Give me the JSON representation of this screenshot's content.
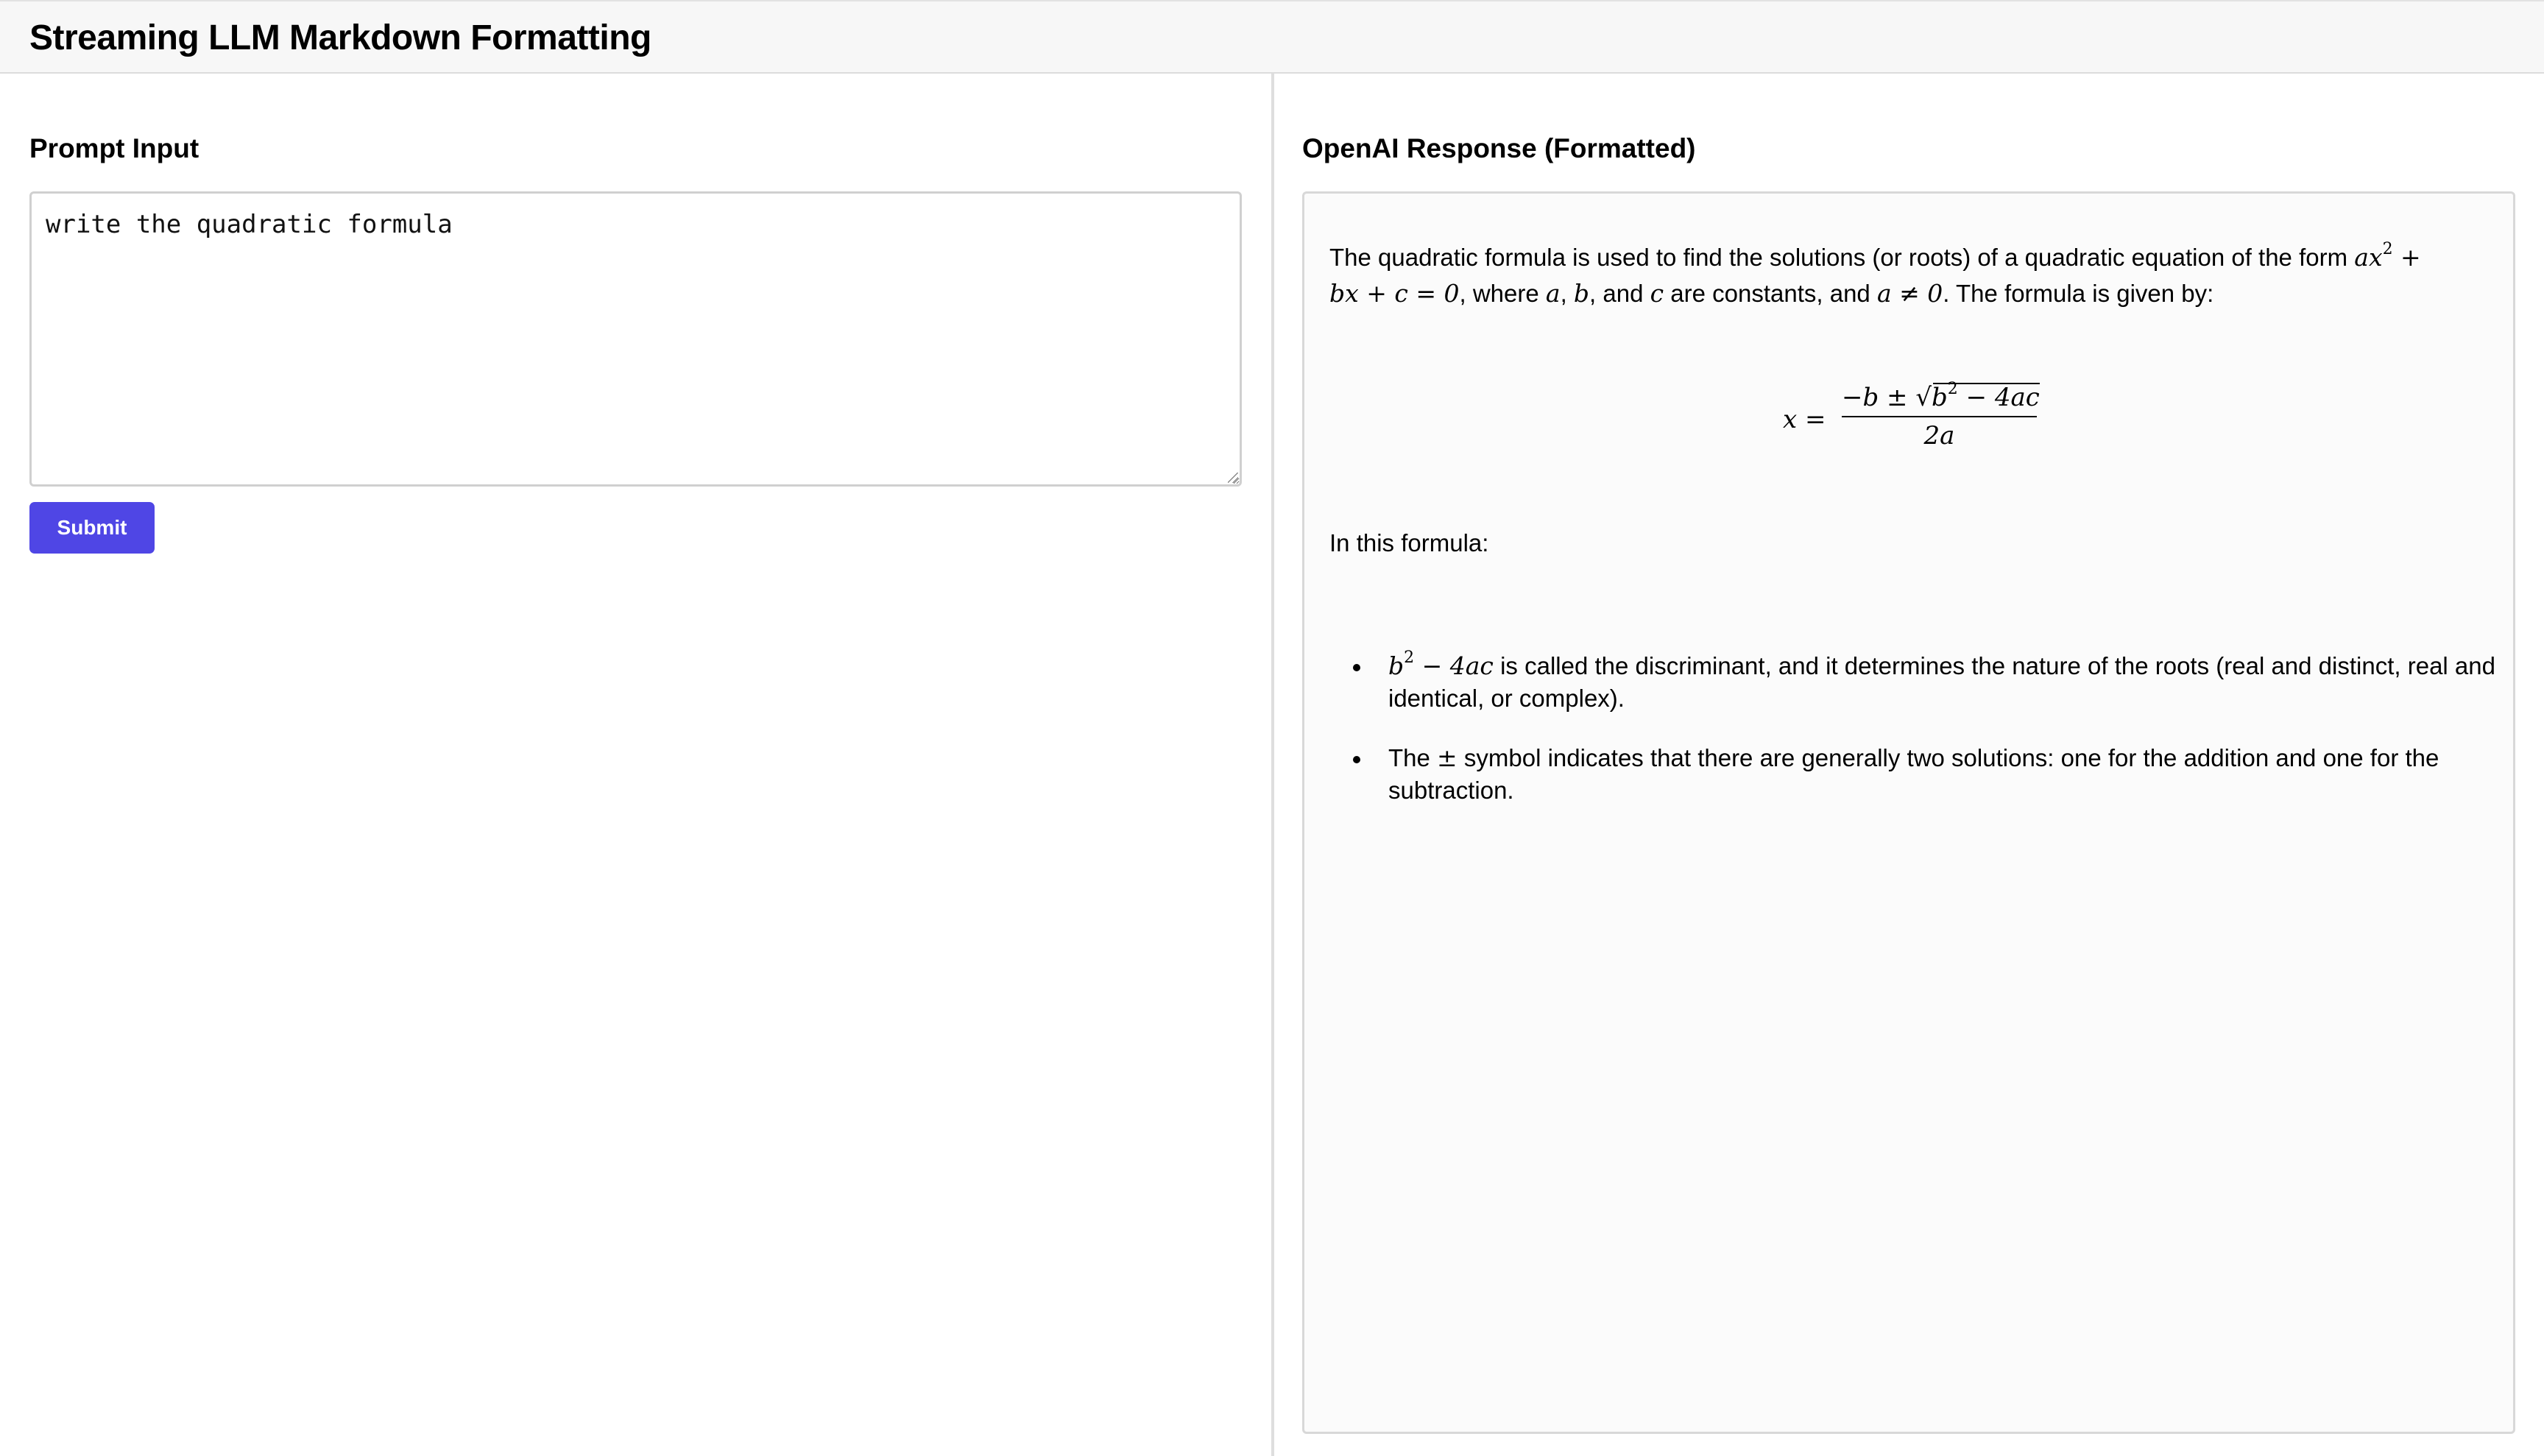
{
  "header": {
    "title": "Streaming LLM Markdown Formatting"
  },
  "left_panel": {
    "title": "Prompt Input",
    "prompt_value": "write the quadratic formula",
    "submit_label": "Submit"
  },
  "right_panel": {
    "title": "OpenAI Response (Formatted)",
    "intro": {
      "t1": "The quadratic formula is used to find the solutions (or roots) of a quadratic equation of the form ",
      "m1": "ax",
      "m1_sup": "2",
      "m1_tail": " +",
      "m2": "bx + c = 0",
      "t2": ", where ",
      "m3": "a",
      "t3": ", ",
      "m4": "b",
      "t4": ", and ",
      "m5": "c",
      "t5": " are constants, and ",
      "m6": "a ≠ 0",
      "t6": ". The formula is given by:"
    },
    "formula": {
      "lhs": "x =",
      "num_prefix": "−b ± ",
      "sqrt_symbol": "√",
      "radicand_b": "b",
      "radicand_sup": "2",
      "radicand_tail": " − 4ac",
      "denominator": "2a"
    },
    "in_this_formula": "In this formula:",
    "bullets": [
      {
        "math": "b",
        "math_sup": "2",
        "math_tail": " − 4ac",
        "text": " is called the discriminant, and it determines the nature of the roots (real and distinct, real and identical, or complex)."
      },
      {
        "pre": "The ",
        "math": "±",
        "text": " symbol indicates that there are generally two solutions: one for the addition and one for the subtraction."
      }
    ]
  },
  "colors": {
    "accent": "#4f46e5",
    "header_bg": "#f7f7f7",
    "response_bg": "#fbfbfb",
    "border": "#d0d0d0"
  }
}
